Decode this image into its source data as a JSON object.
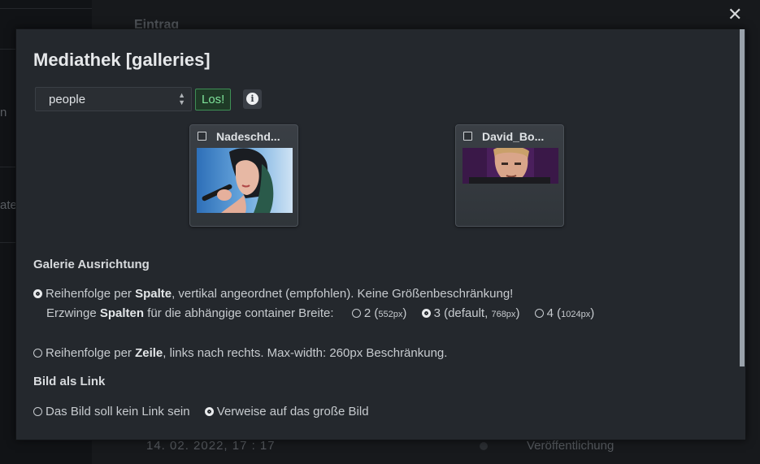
{
  "background": {
    "header": "Eintrag",
    "side_label_1": "n",
    "side_label_2": "ate",
    "date_text": "14. 02. 2022, 17 : 17",
    "publish_label": "Veröffentlichung"
  },
  "close_label": "✕",
  "modal": {
    "title": "Mediathek [galleries]",
    "select_value": "people",
    "go_label": "Los!",
    "info_label": "i",
    "cards": [
      {
        "name": "Nadeschd..."
      },
      {
        "name": "David_Bo..."
      }
    ],
    "gallery_align": {
      "heading": "Galerie Ausrichtung",
      "col_text_pre": "Reihenfolge per ",
      "col_text_bold": "Spalte",
      "col_text_post": ", vertikal angeordnet (empfohlen). Keine Größenbeschränkung!",
      "force_pre": "Erzwinge ",
      "force_bold": "Spalten",
      "force_post": " für die abhängige container Breite:",
      "col_options": [
        {
          "label": "2 (",
          "small": "552px",
          "end": ")"
        },
        {
          "label": "3 (default, ",
          "small": "768px",
          "end": ")"
        },
        {
          "label": "4 (",
          "small": "1024px",
          "end": ")"
        }
      ],
      "row_text_pre": "Reihenfolge per ",
      "row_text_bold": "Zeile",
      "row_text_post": ", links nach rechts. Max-width: 260px Beschränkung."
    },
    "link": {
      "heading": "Bild als Link",
      "option_none": "Das Bild soll kein Link sein",
      "option_big": "Verweise auf das große Bild"
    }
  }
}
